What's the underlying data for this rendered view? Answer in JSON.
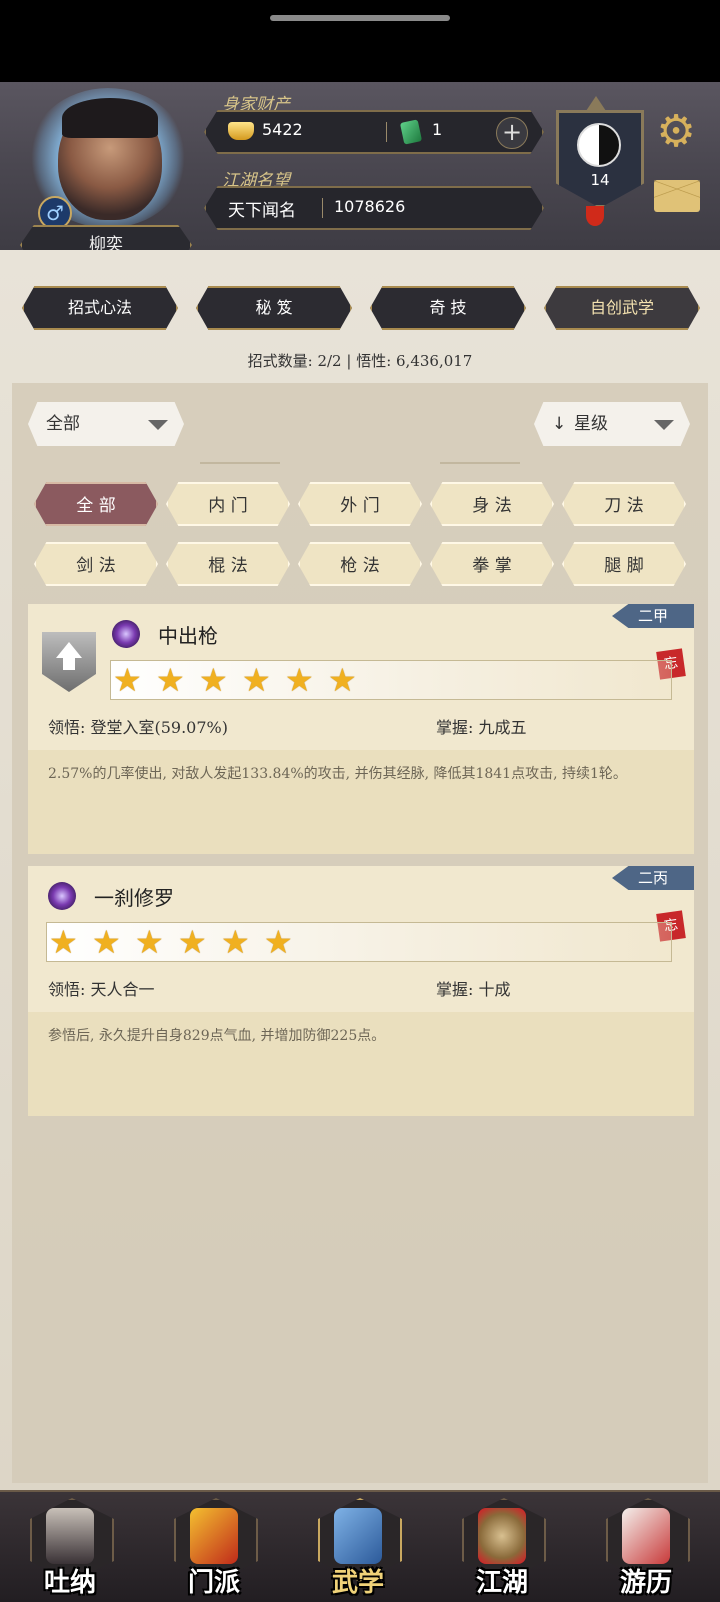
{
  "player": {
    "name": "柳奕",
    "gender_icon": "male-icon"
  },
  "wealth": {
    "label": "身家财产",
    "gold": "5422",
    "jade": "1"
  },
  "fame": {
    "label": "江湖名望",
    "title": "天下闻名",
    "value": "1078626"
  },
  "badge": {
    "level": "14"
  },
  "tabs": [
    "招式心法",
    "秘 笈",
    "奇 技",
    "自创武学"
  ],
  "stats": "招式数量: 2/2 | 悟性: 6,436,017",
  "filters": {
    "dropdown_left": "全部",
    "sort_label": "星级"
  },
  "categories": [
    "全 部",
    "内 门",
    "外 门",
    "身 法",
    "刀 法",
    "剑 法",
    "棍 法",
    "枪 法",
    "拳 掌",
    "腿 脚"
  ],
  "skills": [
    {
      "grade": "二甲",
      "seal": "忘",
      "name": "中出枪",
      "stars": 6,
      "comprehension": "领悟: 登堂入室(59.07%)",
      "mastery": "掌握: 九成五",
      "description": "2.57%的几率使出, 对敌人发起133.84%的攻击, 并伤其经脉, 降低其1841点攻击, 持续1轮。"
    },
    {
      "grade": "二丙",
      "seal": "忘",
      "name": "一刹修罗",
      "stars": 6,
      "comprehension": "领悟: 天人合一",
      "mastery": "掌握: 十成",
      "description": "参悟后, 永久提升自身829点气血, 并增加防御225点。"
    }
  ],
  "bottom_nav": [
    "吐纳",
    "门派",
    "武学",
    "江湖",
    "游历"
  ],
  "colors": {
    "active_filter": "#8b5a5f",
    "grade_tag": "#4e6686",
    "star": "#f0b020",
    "accent_gold": "#d7c489"
  }
}
